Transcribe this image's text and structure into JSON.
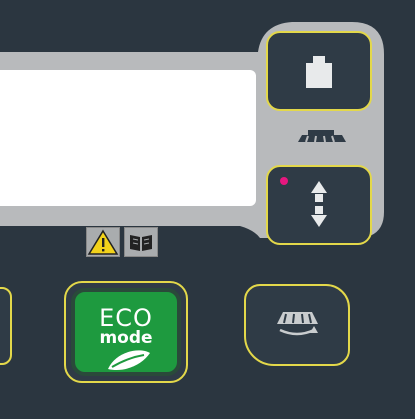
{
  "panel": {
    "background": "#2b3640",
    "bezel_color": "#b8babc",
    "accent_yellow": "#e3d84a",
    "eco_green": "#1e9a3f",
    "indicator_pink": "#e6177f"
  },
  "buttons": {
    "weight": {
      "icon": "weight-icon",
      "state": "off"
    },
    "brush_updown": {
      "icon": "up-down-arrows-icon",
      "indicator": "on"
    },
    "eco": {
      "line1": "ECO",
      "line2": "mode",
      "icon": "leaf-icon",
      "state": "active"
    },
    "brush_rotate": {
      "icon": "rotating-brush-icon"
    }
  },
  "symbols": {
    "brush_deck": "brush-deck-icon",
    "warning": "warning-icon",
    "manual": "manual-book-icon"
  }
}
